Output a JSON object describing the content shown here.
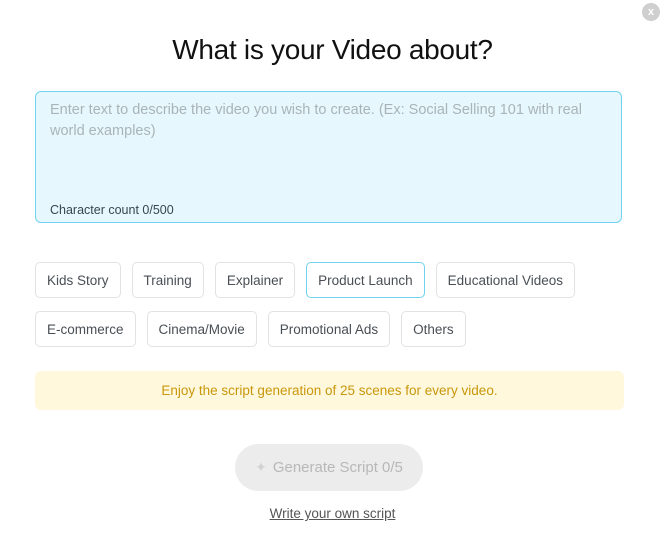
{
  "close_label": "x",
  "title": "What is your Video about?",
  "description": {
    "value": "",
    "placeholder": "Enter text to describe the video you wish to create. (Ex: Social Selling 101 with real world examples)",
    "character_count": "Character count 0/500"
  },
  "categories": [
    {
      "label": "Kids Story",
      "selected": false
    },
    {
      "label": "Training",
      "selected": false
    },
    {
      "label": "Explainer",
      "selected": false
    },
    {
      "label": "Product Launch",
      "selected": true
    },
    {
      "label": "Educational Videos",
      "selected": false
    },
    {
      "label": "E-commerce",
      "selected": false
    },
    {
      "label": "Cinema/Movie",
      "selected": false
    },
    {
      "label": "Promotional Ads",
      "selected": false
    },
    {
      "label": "Others",
      "selected": false
    }
  ],
  "banner": "Enjoy the script generation of 25 scenes for every video.",
  "generate_button": {
    "label": "Generate Script 0/5",
    "icon": "sparkle-icon",
    "disabled": true
  },
  "write_own_link": "Write your own script",
  "colors": {
    "accent": "#6fd3ef",
    "banner_bg": "#fff8dc",
    "banner_text": "#c9970c"
  }
}
